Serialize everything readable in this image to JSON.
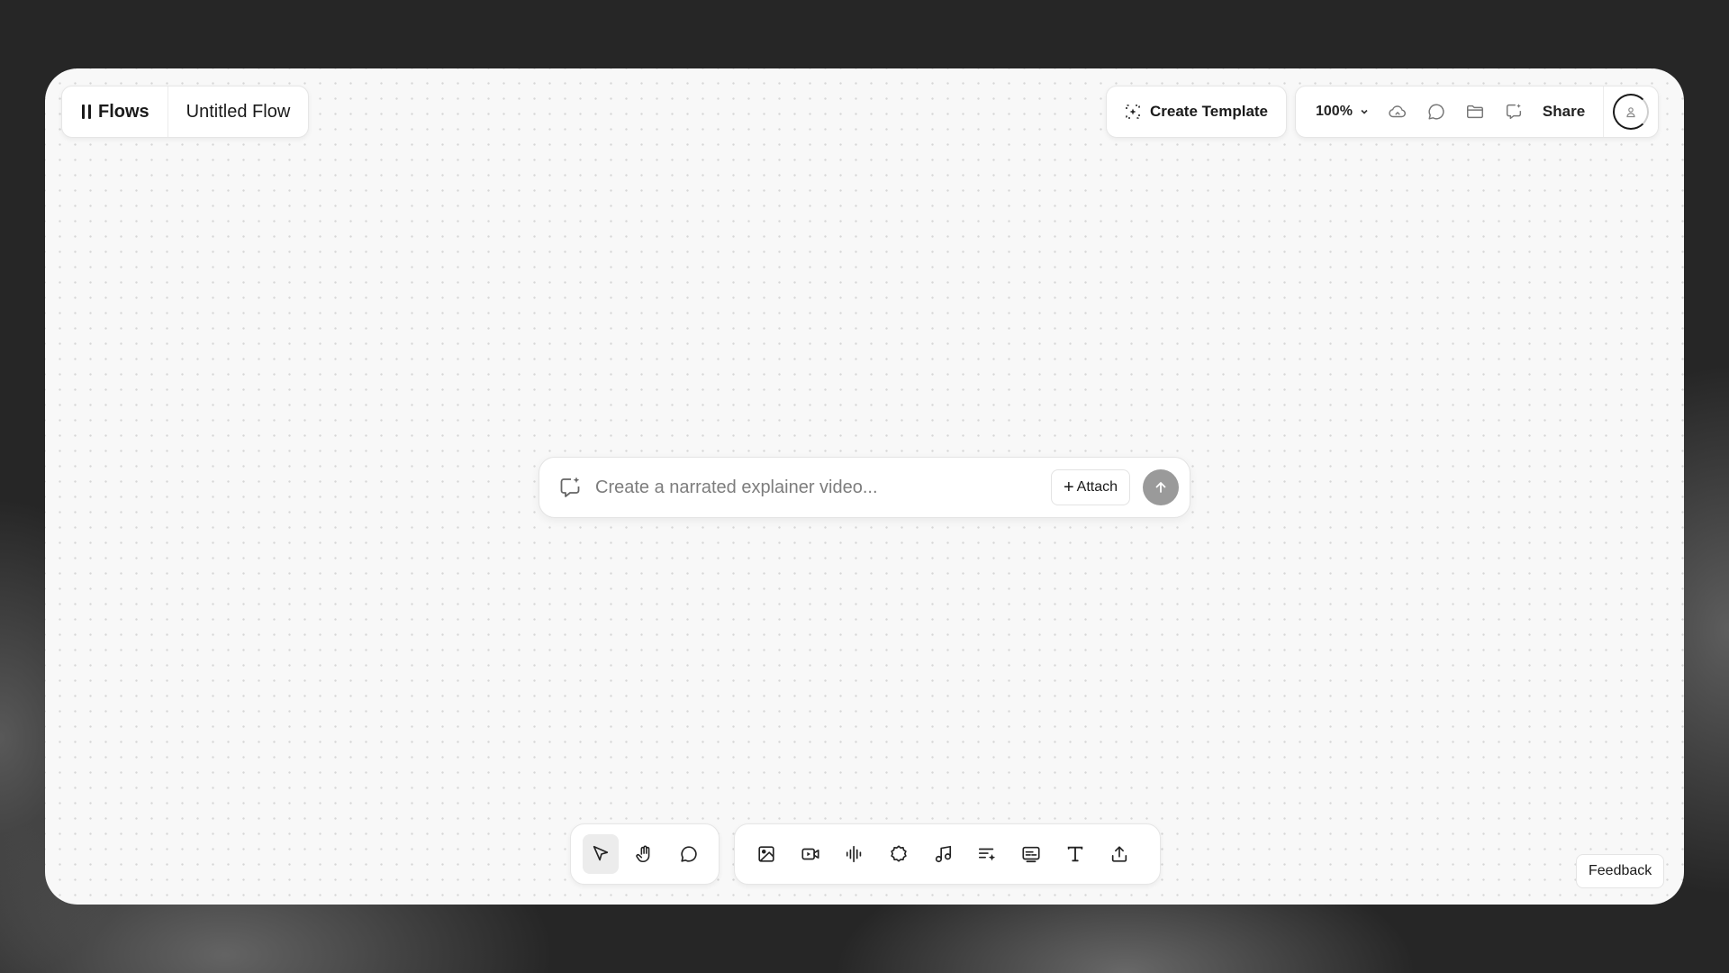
{
  "header": {
    "brand_label": "Flows",
    "flow_title": "Untitled Flow",
    "create_template_label": "Create Template",
    "zoom_level": "100%",
    "share_label": "Share"
  },
  "prompt": {
    "placeholder": "Create a narrated explainer video...",
    "attach_label": "Attach"
  },
  "toolbar": {
    "left_tools": [
      "select-tool",
      "hand-tool",
      "comment-tool"
    ],
    "right_tools": [
      "image-tool",
      "video-tool",
      "audio-tool",
      "effects-tool",
      "music-tool",
      "script-tool",
      "captions-tool",
      "text-tool",
      "upload-tool"
    ],
    "active_tool": "select-tool"
  },
  "feedback_label": "Feedback",
  "colors": {
    "canvas_background": "#f8f8f8",
    "page_background": "#262626",
    "send_button": "#9a9a9a",
    "active_tool": "#ececec"
  }
}
